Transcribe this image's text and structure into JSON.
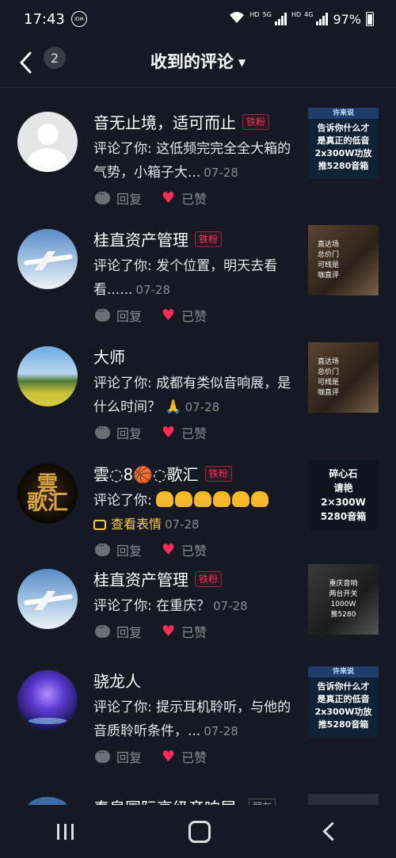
{
  "status_bar": {
    "time": "17:43",
    "idm": "IDM",
    "hd1": "HD",
    "net1": "5G",
    "hd2": "HD",
    "net2": "4G",
    "battery": "97%"
  },
  "header": {
    "back_count": "2",
    "title": "收到的评论"
  },
  "comments": [
    {
      "name": "音无止境，适可而止",
      "tag": "铁粉",
      "text": "评论了你: 这低频完完全全大箱的气势，小箱子大...",
      "date": "07-28",
      "reply": "回复",
      "liked": "已赞",
      "thumb": {
        "header": "许来说",
        "lines": [
          "告诉你什么才",
          "是真正的低音",
          "2x300W功放",
          "推5280音箱"
        ]
      }
    },
    {
      "name": "桂直资产管理",
      "tag": "铁粉",
      "text": "评论了你: 发个位置，明天去看看......",
      "date": "07-28",
      "reply": "回复",
      "liked": "已赞",
      "thumb": {
        "lines": [
          "直达场",
          "总价门",
          "可线是",
          "咖直评"
        ]
      }
    },
    {
      "name": "大师",
      "tag": "",
      "text": "评论了你: 成都有类似音响展，是什么时间？",
      "date": "07-28",
      "reply": "回复",
      "liked": "已赞",
      "thumb": {
        "lines": [
          "直达场",
          "总价门",
          "可线是",
          "咖直评"
        ]
      }
    },
    {
      "name": "雲◌8🏀◌歌汇",
      "tag": "铁粉",
      "text": "评论了你:",
      "sticker": "查看表情",
      "date": "07-28",
      "reply": "回复",
      "liked": "已赞",
      "thumb": {
        "lines": [
          "碎心石",
          "请艳",
          "2×300W",
          "5280音箱"
        ]
      }
    },
    {
      "name": "桂直资产管理",
      "tag": "铁粉",
      "text": "评论了你: 在重庆？",
      "date": "07-28",
      "reply": "回复",
      "liked": "已赞",
      "thumb": {
        "lines": [
          "重庆音响",
          "两台开关",
          "1000W",
          "推5280"
        ]
      }
    },
    {
      "name": "骁龙人",
      "tag": "",
      "text": "评论了你: 提示耳机聆听，与他的音质聆听条件，...",
      "date": "07-28",
      "reply": "回复",
      "liked": "已赞",
      "thumb": {
        "header": "许来说",
        "lines": [
          "告诉你什么才",
          "是真正的低音",
          "2x300W功放",
          "推5280音箱"
        ]
      }
    }
  ],
  "partial_row": {
    "name": "秦皇国际高级音响展",
    "tag": "朋友"
  },
  "icons": {
    "back": "chevron-left-icon",
    "reply": "comment-bubble-icon",
    "like": "heart-icon",
    "sticker": "image-icon"
  },
  "colors": {
    "background": "#161823",
    "accent": "#fe2c55",
    "sticker_link": "#facd3d"
  }
}
